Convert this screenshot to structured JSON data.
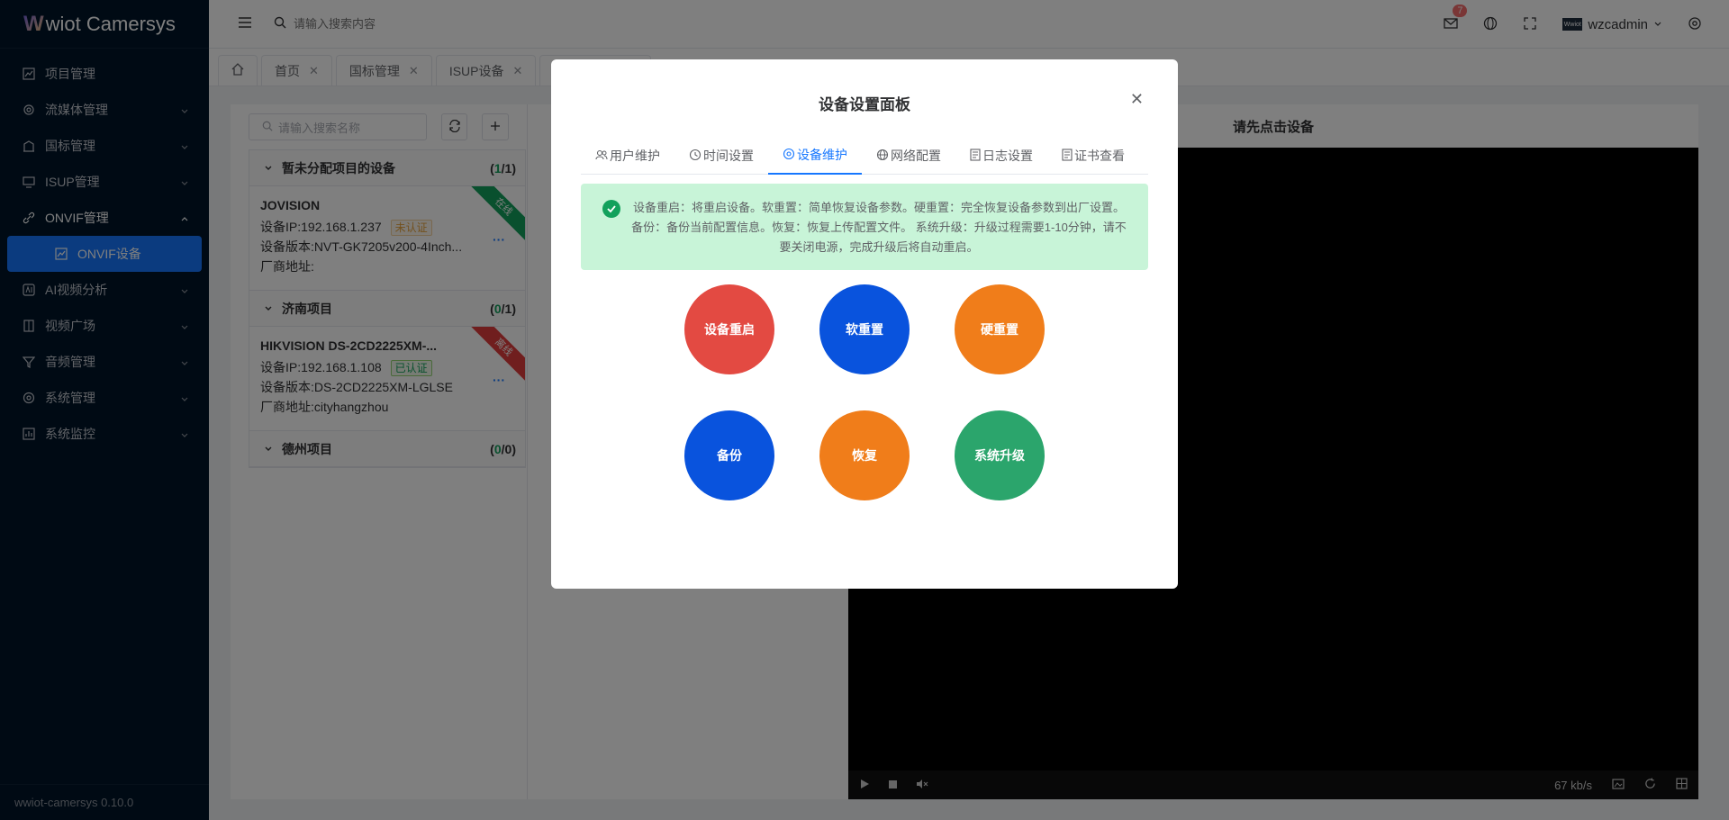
{
  "sidebar": {
    "logo_w": "W",
    "logo_text": "wiot Camersys",
    "items": [
      {
        "label": "项目管理"
      },
      {
        "label": "流媒体管理"
      },
      {
        "label": "国标管理"
      },
      {
        "label": "ISUP管理"
      },
      {
        "label": "ONVIF管理"
      },
      {
        "label": "ONVIF设备"
      },
      {
        "label": "AI视频分析"
      },
      {
        "label": "视频广场"
      },
      {
        "label": "音频管理"
      },
      {
        "label": "系统管理"
      },
      {
        "label": "系统监控"
      }
    ],
    "version": "wwiot-camersys 0.10.0"
  },
  "header": {
    "search_placeholder": "请输入搜索内容",
    "badge_count": "7",
    "avatar_text": "Wwiot",
    "username": "wzcadmin"
  },
  "tabs": [
    {
      "label": "首页"
    },
    {
      "label": "国标管理"
    },
    {
      "label": "ISUP设备"
    }
  ],
  "left_panel": {
    "search_placeholder": "请输入搜索名称",
    "groups": [
      {
        "name": "暂未分配项目的设备",
        "count_a": "1",
        "count_b": "1"
      },
      {
        "name": "济南项目",
        "count_a": "0",
        "count_b": "1"
      },
      {
        "name": "德州项目",
        "count_a": "0",
        "count_b": "0"
      }
    ],
    "devices": [
      {
        "name": "JOVISION",
        "ip": "设备IP:192.168.1.237",
        "tag": "未认证",
        "version": "设备版本:NVT-GK7205v200-4Inch...",
        "vendor": "厂商地址:",
        "ribbon": "在线"
      },
      {
        "name": "HIKVISION DS-2CD2225XM-...",
        "ip": "设备IP:192.168.1.108",
        "tag": "已认证",
        "version": "设备版本:DS-2CD2225XM-LGLSE",
        "vendor": "厂商地址:cityhangzhou",
        "ribbon": "离线"
      }
    ]
  },
  "video": {
    "title": "请先点击设备",
    "bitrate": "67 kb/s"
  },
  "modal": {
    "title": "设备设置面板",
    "tabs": [
      "用户维护",
      "时间设置",
      "设备维护",
      "网络配置",
      "日志设置",
      "证书查看"
    ],
    "alert": "设备重启：将重启设备。软重置：简单恢复设备参数。硬重置：完全恢复设备参数到出厂设置。备份：备份当前配置信息。恢复：恢复上传配置文件。 系统升级：升级过程需要1-10分钟，请不要关闭电源，完成升级后将自动重启。",
    "buttons": [
      {
        "label": "设备重启",
        "color": "#e34a42"
      },
      {
        "label": "软重置",
        "color": "#0953dd"
      },
      {
        "label": "硬重置",
        "color": "#f07d1a"
      },
      {
        "label": "备份",
        "color": "#0953dd"
      },
      {
        "label": "恢复",
        "color": "#f07d1a"
      },
      {
        "label": "系统升级",
        "color": "#2ba56c"
      }
    ]
  }
}
